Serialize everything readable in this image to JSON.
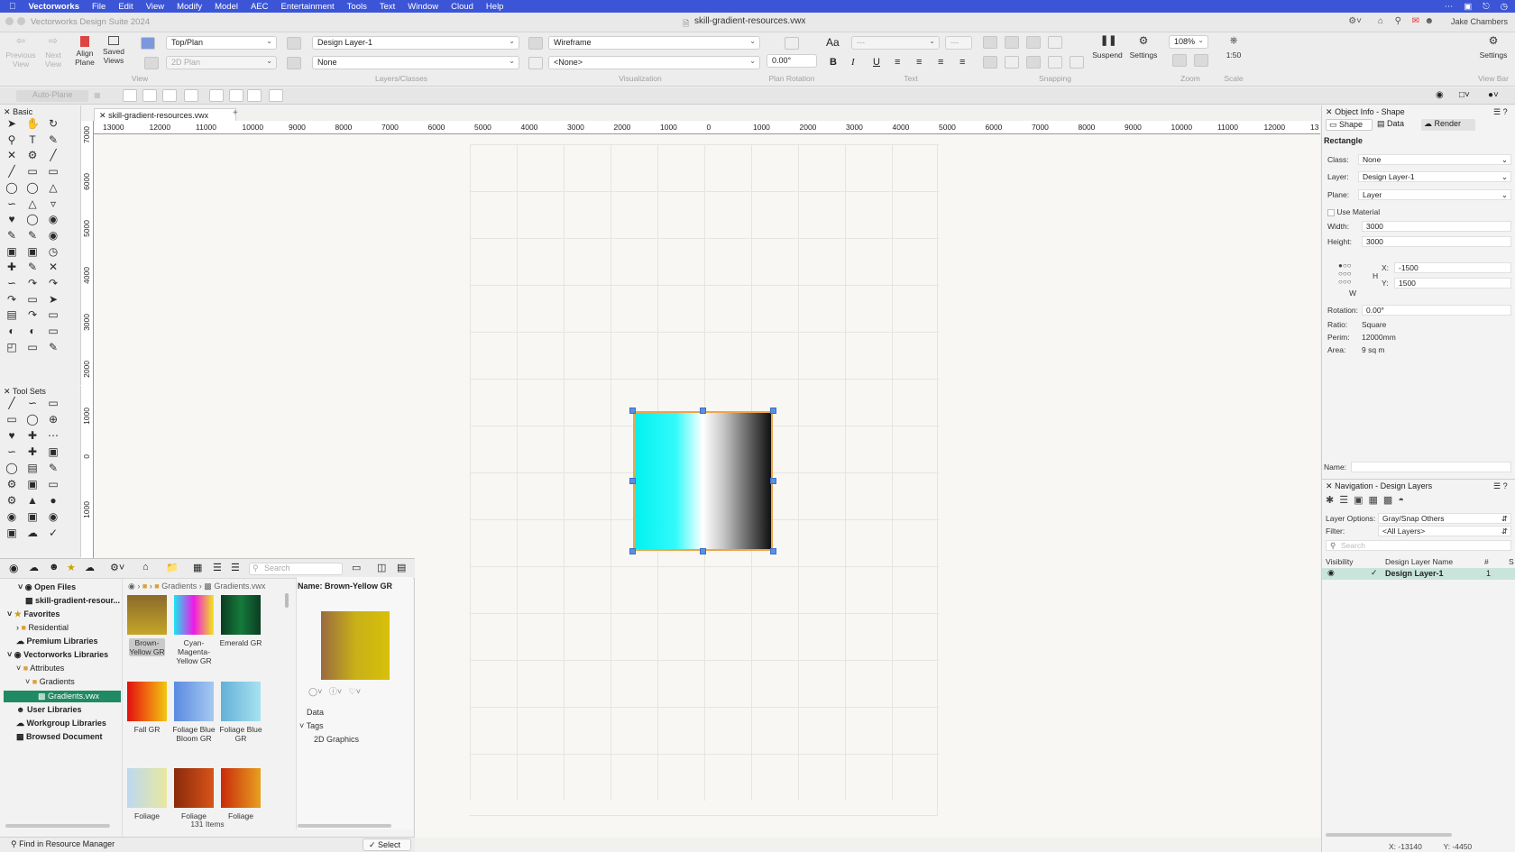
{
  "menubar": {
    "app": "Vectorworks",
    "items": [
      "File",
      "Edit",
      "View",
      "Modify",
      "Model",
      "AEC",
      "Entertainment",
      "Tools",
      "Text",
      "Window",
      "Cloud",
      "Help"
    ],
    "right_icons": [
      "more-icon",
      "window-icon",
      "bell-icon",
      "clock-icon"
    ]
  },
  "titlebar": {
    "app_title": "Vectorworks Design Suite 2024",
    "doc_title": "skill-gradient-resources.vwx",
    "user": "Jake Chambers"
  },
  "toolbar": {
    "previous_view": "Previous View",
    "next_view": "Next View",
    "align_plane": "Align Plane",
    "saved_views": "Saved Views",
    "view_label": "View",
    "view_dropdown": "Top/Plan",
    "plane_dropdown": "2D Plan",
    "layer_dropdown": "Design Layer-1",
    "class_dropdown": "None",
    "layers_classes_label": "Layers/Classes",
    "render_dropdown": "Wireframe",
    "projection_dropdown": "<None>",
    "visualization_label": "Visualization",
    "rotation_value": "0.00°",
    "plan_rotation_label": "Plan Rotation",
    "font_size": "Aa",
    "text_label": "Text",
    "snapping_label": "Snapping",
    "suspend": "Suspend",
    "settings": "Settings",
    "zoom_value": "108%",
    "zoom_label": "Zoom",
    "scale_value": "1:50",
    "scale_label": "Scale",
    "settings_right": "Settings",
    "view_bar": "View Bar",
    "auto_plane": "Auto-Plane"
  },
  "palettes": {
    "basic": "Basic",
    "tool_sets": "Tool Sets"
  },
  "document": {
    "tab": "skill-gradient-resources.vwx",
    "ruler_h": [
      "13000",
      "12000",
      "11000",
      "10000",
      "9000",
      "8000",
      "7000",
      "6000",
      "5000",
      "4000",
      "3000",
      "2000",
      "1000",
      "0",
      "1000",
      "2000",
      "3000",
      "4000",
      "5000",
      "6000",
      "7000",
      "8000",
      "9000",
      "10000",
      "11000",
      "12000",
      "13"
    ],
    "ruler_v": [
      "7000",
      "6000",
      "5000",
      "4000",
      "3000",
      "2000",
      "1000",
      "0",
      "1000"
    ]
  },
  "resource_manager": {
    "search_placeholder": "Search",
    "tree": {
      "open_files": "Open Files",
      "open_file_item": "skill-gradient-resour...",
      "favorites": "Favorites",
      "residential": "Residential",
      "premium": "Premium Libraries",
      "vw_libraries": "Vectorworks Libraries",
      "attributes": "Attributes",
      "gradients": "Gradients",
      "gradients_file": "Gradients.vwx",
      "user_libraries": "User Libraries",
      "workgroup": "Workgroup Libraries",
      "browsed": "Browsed Document"
    },
    "breadcrumb": [
      "Gradients",
      "Gradients.vwx"
    ],
    "resources": [
      {
        "name": "Brown-Yellow GR",
        "color": "linear-gradient(#8a6a2a,#c4a628)"
      },
      {
        "name": "Cyan-Magenta-Yellow GR",
        "color": "linear-gradient(to right,#19e7f0,#f018e8,#f0e818)"
      },
      {
        "name": "Emerald GR",
        "color": "linear-gradient(to right,#0a3d22,#167a3c,#0a3d22)"
      },
      {
        "name": "Fall GR",
        "color": "linear-gradient(to right,#e01010,#f06a10,#f0c810)"
      },
      {
        "name": "Foliage Blue Bloom GR",
        "color": "linear-gradient(to right,#5a8be0,#a6c8f0)"
      },
      {
        "name": "Foliage Blue GR",
        "color": "linear-gradient(to right,#64b0d8,#a8e2f0)"
      },
      {
        "name": "Foliage",
        "color": "linear-gradient(to right,#bcd8f0,#e8e8a0)"
      },
      {
        "name": "Foliage",
        "color": "linear-gradient(to right,#8a2a0a,#d8541a)"
      },
      {
        "name": "Foliage",
        "color": "linear-gradient(to right,#c82a0a,#e8a020)"
      }
    ],
    "count": "131 Items",
    "preview_name": "Name: Brown-Yellow GR",
    "preview_color": "linear-gradient(to right,#9a6a40,#c8b018,#d8c00a)",
    "data_label": "Data",
    "tags_label": "Tags",
    "tag_value": "2D Graphics",
    "find_button": "Find in Resource Manager",
    "select_button": "Select"
  },
  "object_info": {
    "title": "Object Info - Shape",
    "tabs": [
      "Shape",
      "Data",
      "Render"
    ],
    "object_type": "Rectangle",
    "class_label": "Class:",
    "class_value": "None",
    "layer_label": "Layer:",
    "layer_value": "Design Layer-1",
    "plane_label": "Plane:",
    "plane_value": "Layer",
    "use_material": "Use Material",
    "width_label": "Width:",
    "width_value": "3000",
    "height_label": "Height:",
    "height_value": "3000",
    "h_label": "H",
    "w_label": "W",
    "x_label": "X:",
    "x_value": "-1500",
    "y_label": "Y:",
    "y_value": "1500",
    "rotation_label": "Rotation:",
    "rotation_value": "0.00°",
    "ratio_label": "Ratio:",
    "ratio_value": "Square",
    "perim_label": "Perim:",
    "perim_value": "12000mm",
    "area_label": "Area:",
    "area_value": "9 sq m",
    "name_label": "Name:"
  },
  "navigation": {
    "title": "Navigation - Design Layers",
    "layer_options_label": "Layer Options:",
    "layer_options_value": "Gray/Snap Others",
    "filter_label": "Filter:",
    "filter_value": "<All Layers>",
    "search_placeholder": "Search",
    "col_visibility": "Visibility",
    "col_name": "Design Layer Name",
    "col_num": "#",
    "col_s": "S",
    "layer_name": "Design Layer-1",
    "layer_num": "1"
  },
  "status": {
    "x": "X: -13140",
    "y": "Y: -4450"
  },
  "colors": {
    "menubar": "#3c55d6",
    "selection_green": "#1f8a63",
    "handle_blue": "#5b8fe0",
    "shape_outline": "#f1a446"
  }
}
